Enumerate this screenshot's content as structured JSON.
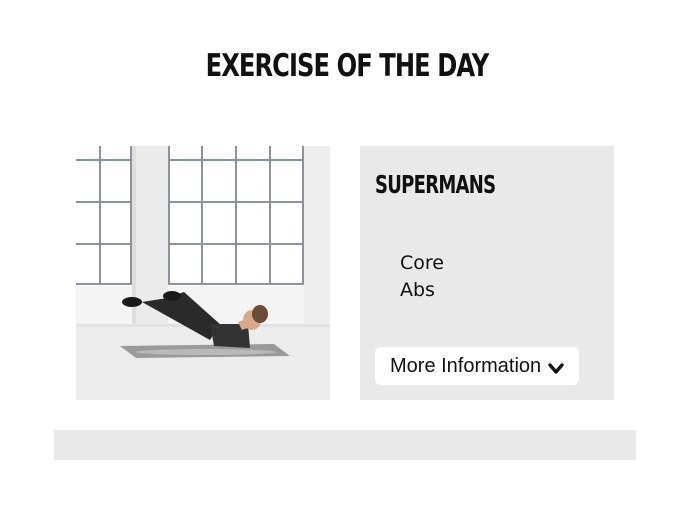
{
  "section": {
    "title": "EXERCISE OF THE DAY"
  },
  "exercise": {
    "name": "SUPERMANS",
    "muscles": [
      "Core",
      "Abs"
    ],
    "more_info_label": "More Information",
    "more_info_icon": "chevron-down-icon",
    "photo_icon": "exercise-photo"
  },
  "colors": {
    "card_background": "#e9e9e9",
    "text": "#111111",
    "button_background": "#ffffff"
  }
}
